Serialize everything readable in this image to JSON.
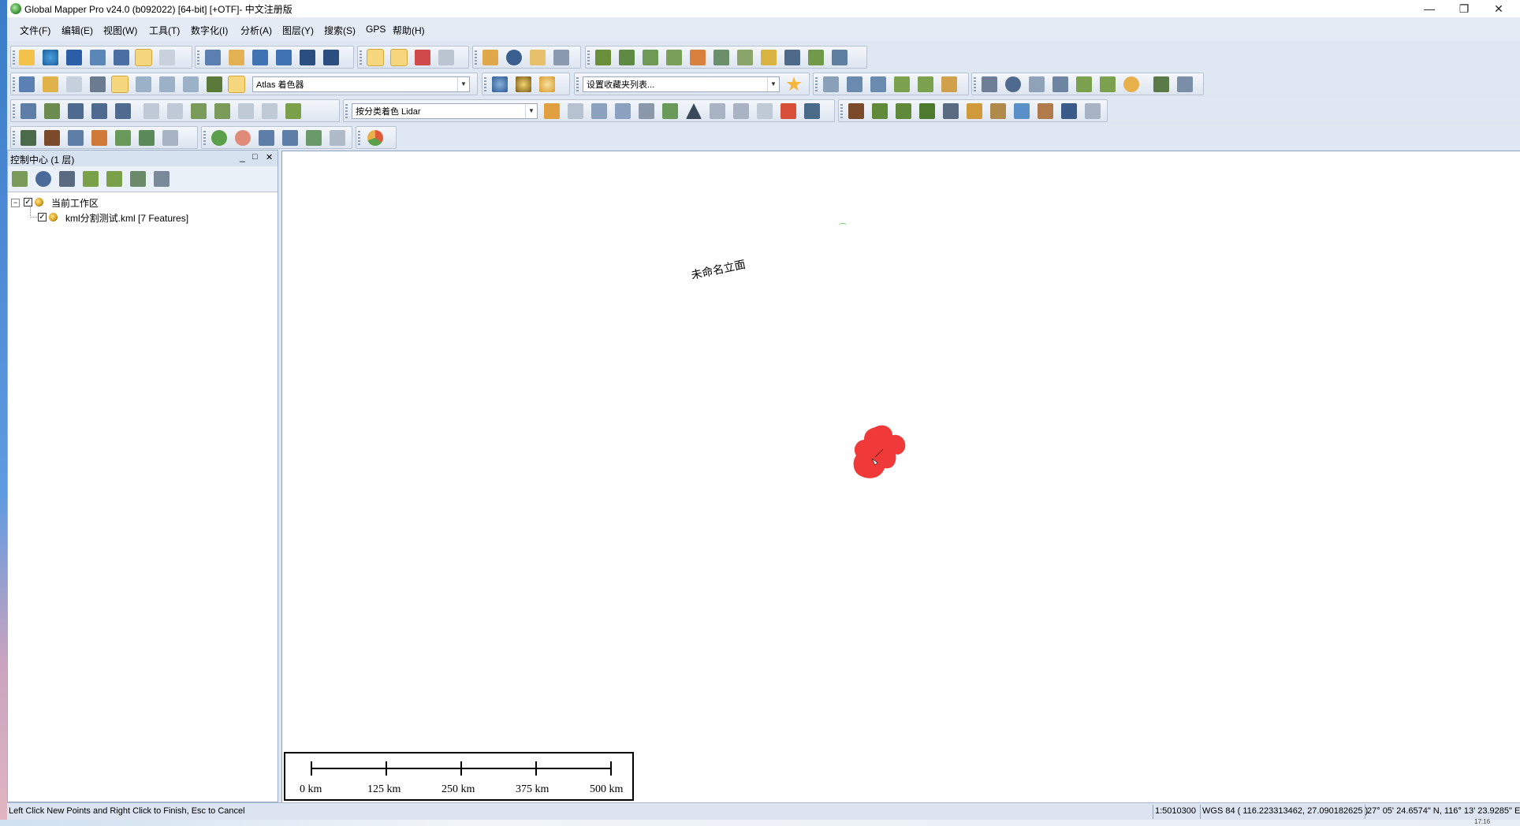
{
  "window": {
    "title": "Global Mapper Pro v24.0 (b092022) [64-bit] [+OTF]- 中文注册版",
    "minimize": "—",
    "restore": "❐",
    "close": "✕"
  },
  "menu": [
    "文件(F)",
    "编辑(E)",
    "视图(W)",
    "工具(T)",
    "数字化(I)",
    "分析(A)",
    "图层(Y)",
    "搜索(S)",
    "GPS",
    "帮助(H)"
  ],
  "toolbars": {
    "shader_combo": "Atlas 着色器",
    "favorites_combo": "设置收藏夹列表...",
    "lidar_combo": "按分类着色 Lidar"
  },
  "control_center": {
    "title": "控制中心 (1 层)",
    "minimize": "_",
    "maximize": "□",
    "close": "✕",
    "tree": {
      "root_label": "当前工作区",
      "layer_label": "kml分割测试.kml [7 Features]"
    }
  },
  "map": {
    "feature_label": "未命名立面",
    "scale_labels": [
      "0 km",
      "125 km",
      "250 km",
      "375 km",
      "500 km"
    ]
  },
  "status": {
    "hint": "Left Click New Points and Right Click to Finish, Esc to Cancel",
    "scale": "1:5010300",
    "projection": "WGS 84 ( 116.223313462, 27.090182625 )",
    "dms": "27° 05' 24.6574\" N, 116° 13' 23.9285\" E",
    "clock": "17:16"
  },
  "colors": {
    "feature_fill": "#f03a3a",
    "highlight": "#f7d77e"
  }
}
